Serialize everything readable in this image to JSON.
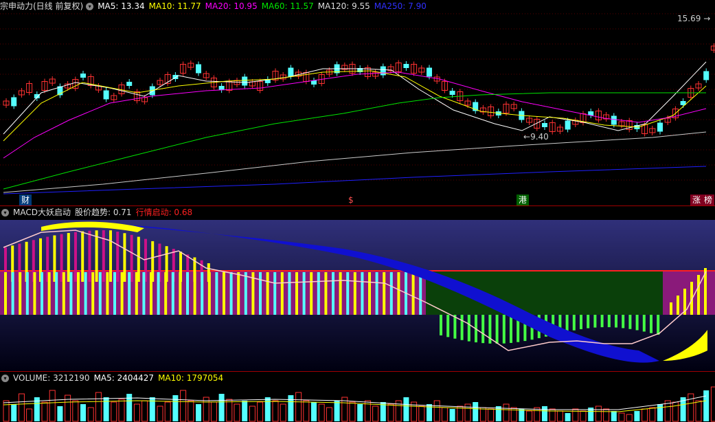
{
  "main": {
    "title": "宗申动力(日线 前复权)",
    "ma5": "MA5: 13.34",
    "ma10": "MA10: 11.77",
    "ma20": "MA20: 10.95",
    "ma60": "MA60: 11.57",
    "ma120": "MA120: 9.55",
    "ma250": "MA250: 7.90",
    "high_label": "15.69",
    "low_label": "9.40",
    "badges": [
      "财",
      "$",
      "港",
      "涨",
      "榜"
    ]
  },
  "macd": {
    "title": "MACD大妖启动",
    "trend": "股价趋势: 0.71",
    "start": "行情启动: 0.68"
  },
  "volume": {
    "title": "VOLUME: 3212190",
    "ma5": "MA5: 2404427",
    "ma10": "MA10: 1797054"
  },
  "colors": {
    "up": "#ff3232",
    "down": "#54ffff",
    "ma5": "#ffffff",
    "ma10": "#ffff00",
    "ma20": "#ff00ff",
    "ma60": "#00e600",
    "ma120": "#cccccc",
    "ma250": "#2020ff",
    "start_red": "#ff2020"
  }
}
